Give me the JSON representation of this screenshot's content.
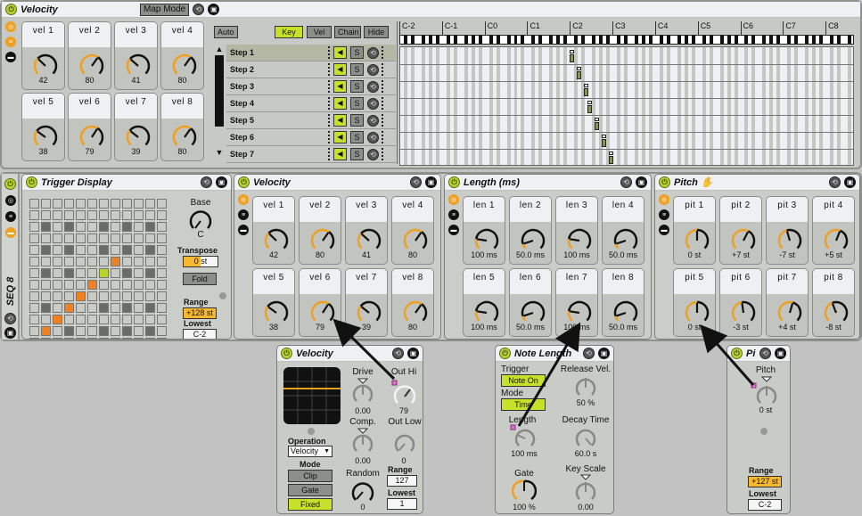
{
  "top_velocity": {
    "title": "Velocity",
    "map_mode": "Map Mode",
    "macros": [
      {
        "label": "vel  1",
        "value": "42",
        "f": 0.33
      },
      {
        "label": "vel  2",
        "value": "80",
        "f": 0.63
      },
      {
        "label": "vel  3",
        "value": "41",
        "f": 0.32
      },
      {
        "label": "vel  4",
        "value": "80",
        "f": 0.63
      },
      {
        "label": "vel  5",
        "value": "38",
        "f": 0.3
      },
      {
        "label": "vel  6",
        "value": "79",
        "f": 0.62
      },
      {
        "label": "vel  7",
        "value": "39",
        "f": 0.31
      },
      {
        "label": "vel  8",
        "value": "80",
        "f": 0.63
      }
    ]
  },
  "chain": {
    "auto": "Auto",
    "key": "Key",
    "vel": "Vel",
    "chain": "Chain",
    "hide": "Hide",
    "steps": [
      "Step 1",
      "Step 2",
      "Step 3",
      "Step 4",
      "Step 5",
      "Step 6",
      "Step 7"
    ],
    "solo": "S",
    "octaves": [
      "C-2",
      "C-1",
      "C0",
      "C1",
      "C2",
      "C3",
      "C4",
      "C5",
      "C6",
      "C7",
      "C8"
    ],
    "step_notes": [
      48,
      50,
      52,
      53,
      55,
      57,
      59
    ]
  },
  "rack_name": "SEQ 8",
  "trigger": {
    "title": "Trigger Display",
    "base_label": "Base",
    "base_value": "C",
    "transpose_label": "Transpose",
    "transpose_value": "0 st",
    "fold": "Fold",
    "range_label": "Range",
    "range_value": "+128 st",
    "lowest_label": "Lowest",
    "lowest_value": "C-2",
    "grid_dark": [
      [
        2,
        1
      ],
      [
        2,
        3
      ],
      [
        2,
        6
      ],
      [
        2,
        8
      ],
      [
        2,
        10
      ],
      [
        4,
        1
      ],
      [
        4,
        3
      ],
      [
        4,
        6
      ],
      [
        4,
        8
      ],
      [
        4,
        10
      ],
      [
        6,
        1
      ],
      [
        6,
        3
      ],
      [
        6,
        8
      ],
      [
        6,
        10
      ],
      [
        9,
        1
      ],
      [
        9,
        6
      ],
      [
        9,
        8
      ],
      [
        9,
        10
      ],
      [
        11,
        3
      ],
      [
        11,
        6
      ],
      [
        11,
        8
      ],
      [
        11,
        10
      ]
    ],
    "grid_orange": [
      [
        5,
        7
      ],
      [
        7,
        5
      ],
      [
        8,
        4
      ],
      [
        9,
        3
      ],
      [
        10,
        2
      ],
      [
        11,
        1
      ],
      [
        12,
        0
      ]
    ],
    "grid_green": [
      [
        6,
        6
      ]
    ]
  },
  "velocity": {
    "title": "Velocity",
    "macros": [
      {
        "label": "vel  1",
        "value": "42",
        "f": 0.33
      },
      {
        "label": "vel  2",
        "value": "80",
        "f": 0.63
      },
      {
        "label": "vel  3",
        "value": "41",
        "f": 0.32
      },
      {
        "label": "vel  4",
        "value": "80",
        "f": 0.63
      },
      {
        "label": "vel  5",
        "value": "38",
        "f": 0.3
      },
      {
        "label": "vel  6",
        "value": "79",
        "f": 0.62
      },
      {
        "label": "vel  7",
        "value": "39",
        "f": 0.31
      },
      {
        "label": "vel  8",
        "value": "80",
        "f": 0.63
      }
    ]
  },
  "length": {
    "title": "Length (ms)",
    "macros": [
      {
        "label": "len  1",
        "value": "100 ms",
        "f": 0.2
      },
      {
        "label": "len  2",
        "value": "50.0 ms",
        "f": 0.1
      },
      {
        "label": "len  3",
        "value": "100 ms",
        "f": 0.2
      },
      {
        "label": "len  4",
        "value": "50.0 ms",
        "f": 0.1
      },
      {
        "label": "len  5",
        "value": "100 ms",
        "f": 0.2
      },
      {
        "label": "len  6",
        "value": "50.0 ms",
        "f": 0.1
      },
      {
        "label": "len  7",
        "value": "100 ms",
        "f": 0.2
      },
      {
        "label": "len  8",
        "value": "50.0 ms",
        "f": 0.1
      }
    ]
  },
  "pitch": {
    "title": "Pitch",
    "macros": [
      {
        "label": "pit  1",
        "value": "0 st",
        "f": 0.5
      },
      {
        "label": "pit  2",
        "value": "+7 st",
        "f": 0.6
      },
      {
        "label": "pit  3",
        "value": "-7 st",
        "f": 0.44
      },
      {
        "label": "pit  4",
        "value": "+5 st",
        "f": 0.58
      },
      {
        "label": "pit  5",
        "value": "0 st",
        "f": 0.5
      },
      {
        "label": "pit  6",
        "value": "-3 st",
        "f": 0.47
      },
      {
        "label": "pit  7",
        "value": "+4 st",
        "f": 0.56
      },
      {
        "label": "pit  8",
        "value": "-8 st",
        "f": 0.42
      }
    ]
  },
  "vel_device": {
    "title": "Velocity",
    "drive_label": "Drive",
    "drive_value": "0.00",
    "outhi_label": "Out Hi",
    "outhi_value": "79",
    "comp_label": "Comp.",
    "comp_value": "0.00",
    "outlow_label": "Out Low",
    "outlow_value": "0",
    "operation_label": "Operation",
    "operation_value": "Velocity",
    "mode_label": "Mode",
    "clip": "Clip",
    "gate": "Gate",
    "fixed": "Fixed",
    "random_label": "Random",
    "random_value": "0",
    "range_label": "Range",
    "range_value": "127",
    "lowest_label": "Lowest",
    "lowest_value": "1"
  },
  "note_length": {
    "title": "Note Length",
    "trigger_label": "Trigger",
    "trigger_value": "Note On",
    "mode_label": "Mode",
    "mode_value": "Time",
    "release_label": "Release Vel.",
    "release_value": "50 %",
    "length_label": "Length",
    "length_value": "100 ms",
    "decay_label": "Decay Time",
    "decay_value": "60.0 s",
    "gate_label": "Gate",
    "gate_value": "100 %",
    "keyscale_label": "Key Scale",
    "keyscale_value": "0.00"
  },
  "pitch_device": {
    "title": "Pit...",
    "pitch_label": "Pitch",
    "pitch_value": "0 st",
    "range_label": "Range",
    "range_value": "+127 st",
    "lowest_label": "Lowest",
    "lowest_value": "C-2"
  }
}
